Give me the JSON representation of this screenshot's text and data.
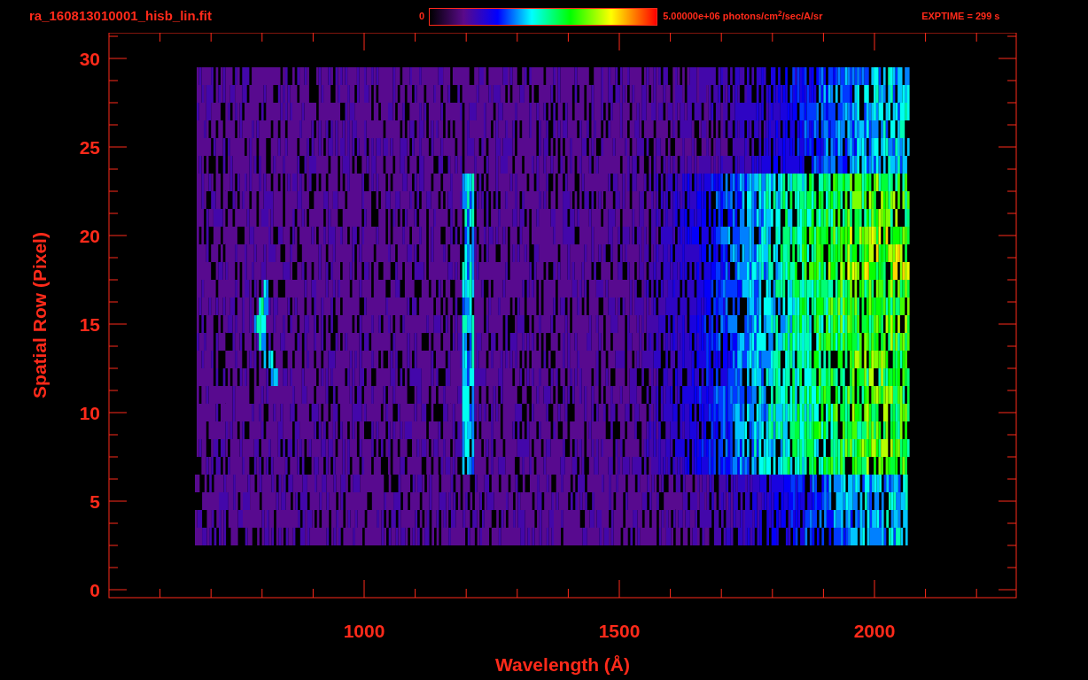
{
  "header": {
    "title": "ra_160813010001_hisb_lin.fit",
    "colorbar": {
      "min_label": "0",
      "max_label": "5.00000e+06 photons/cm$^{2}$/sec/A/sr"
    },
    "exposure": "EXPTIME = 299 s"
  },
  "plot": {
    "xlabel": "Wavelength (Å)",
    "ylabel": "Spatial Row (Pixel)",
    "xticks": [
      "1000",
      "1500",
      "2000"
    ],
    "yticks": [
      "30",
      "25",
      "20",
      "15",
      "10",
      "5",
      "0"
    ]
  }
}
